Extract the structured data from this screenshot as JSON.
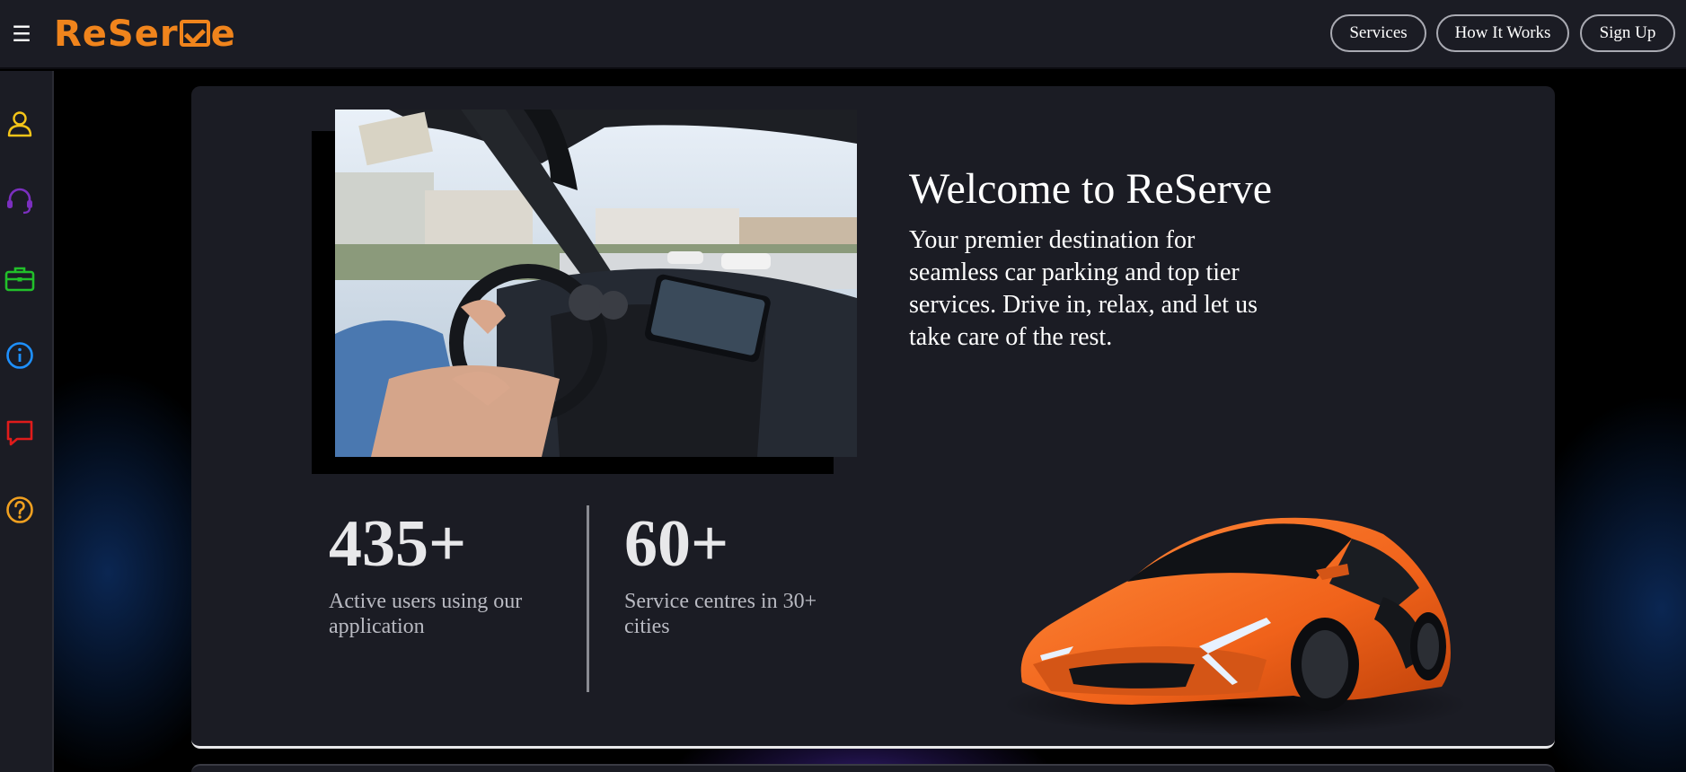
{
  "header": {
    "menu_icon": "hamburger-icon",
    "logo_text_start": "ReSer",
    "logo_text_end": "e",
    "logo_icon": "checkbox-v-icon",
    "nav": [
      {
        "label": "Services"
      },
      {
        "label": "How It Works"
      },
      {
        "label": "Sign Up"
      }
    ]
  },
  "sidebar": {
    "items": [
      {
        "icon": "user-icon",
        "color": "#f5c518"
      },
      {
        "icon": "headset-icon",
        "color": "#7b2fbf"
      },
      {
        "icon": "briefcase-icon",
        "color": "#22c02a"
      },
      {
        "icon": "info-icon",
        "color": "#1e90ff"
      },
      {
        "icon": "chat-icon",
        "color": "#e01b1b"
      },
      {
        "icon": "help-icon",
        "color": "#f0a020"
      }
    ]
  },
  "hero": {
    "title": "Welcome to ReServe",
    "description": "Your premier destination for seamless car parking and top tier services. Drive in, relax, and let us take care of the rest.",
    "photo": "person-driving-car-interior-photo",
    "car_image": "orange-sports-car-image"
  },
  "stats": [
    {
      "value": "435+",
      "label": "Active users using our application"
    },
    {
      "value": "60+",
      "label": "Service centres in 30+ cities"
    }
  ],
  "colors": {
    "brand": "#f0841c",
    "panel": "#1b1c24",
    "background": "#000000"
  }
}
